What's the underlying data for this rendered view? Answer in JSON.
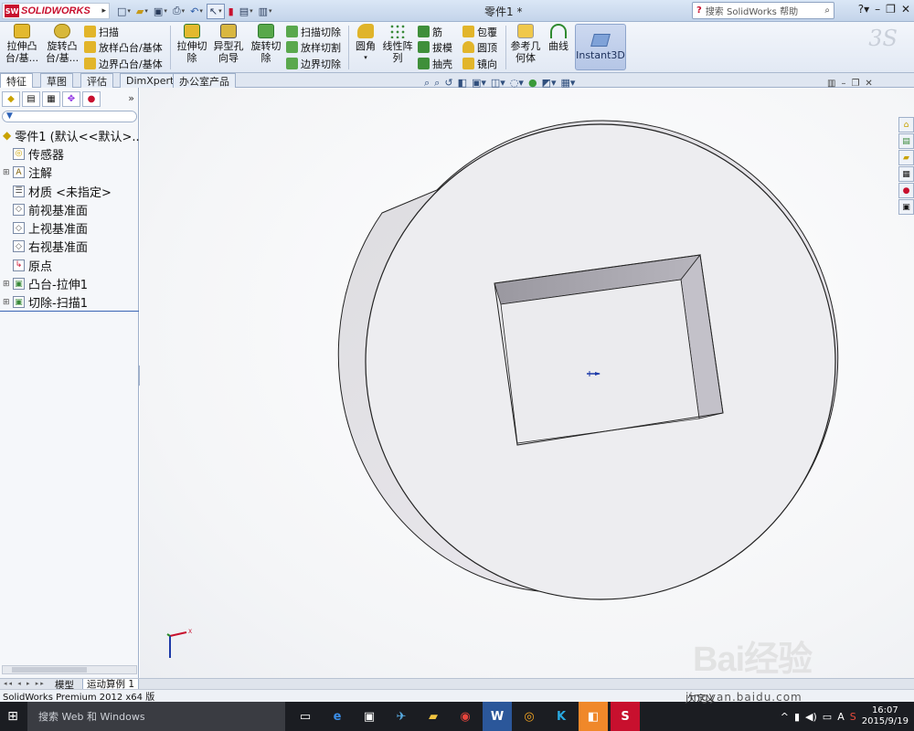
{
  "app": {
    "brand": "SOLIDWORKS",
    "doc_title": "零件1 *",
    "search_placeholder": "搜索 SolidWorks 帮助"
  },
  "quick_access": [
    "new-icon",
    "open-icon",
    "save-icon",
    "print-icon",
    "undo-icon",
    "select-icon",
    "rebuild-icon",
    "file-properties-icon",
    "options-icon"
  ],
  "ribbon": {
    "extrude_boss": "拉伸凸\n台/基...",
    "revolve_boss": "旋转凸\n台/基...",
    "sweep": "扫描",
    "loft_boss": "放样凸台/基体",
    "boundary_boss": "边界凸台/基体",
    "extrude_cut": "拉伸切\n除",
    "hole_wizard": "异型孔\n向导",
    "revolve_cut": "旋转切\n除",
    "sweep_cut": "扫描切除",
    "loft_cut": "放样切割",
    "boundary_cut": "边界切除",
    "fillet": "圆角",
    "linear_pattern": "线性阵\n列",
    "rib": "筋",
    "draft": "拔模",
    "shell": "抽壳",
    "wrap": "包覆",
    "dome": "圆顶",
    "mirror": "镜向",
    "ref_geometry": "参考几\n何体",
    "curves": "曲线",
    "instant3d": "Instant3D"
  },
  "tabs": [
    "特征",
    "草图",
    "评估",
    "DimXpert",
    "办公室产品"
  ],
  "tree": {
    "root": "零件1 (默认<<默认>...",
    "items": [
      {
        "label": "传感器",
        "icon": "sensor-icon",
        "expandable": false
      },
      {
        "label": "注解",
        "icon": "annotation-icon",
        "expandable": true
      },
      {
        "label": "材质 <未指定>",
        "icon": "material-icon",
        "expandable": false
      },
      {
        "label": "前视基准面",
        "icon": "plane-icon",
        "expandable": false
      },
      {
        "label": "上视基准面",
        "icon": "plane-icon",
        "expandable": false
      },
      {
        "label": "右视基准面",
        "icon": "plane-icon",
        "expandable": false
      },
      {
        "label": "原点",
        "icon": "origin-icon",
        "expandable": false
      },
      {
        "label": "凸台-拉伸1",
        "icon": "extrude-icon",
        "expandable": true
      },
      {
        "label": "切除-扫描1",
        "icon": "cut-sweep-icon",
        "expandable": true
      }
    ]
  },
  "bottom_tabs": [
    "模型",
    "运动算例 1"
  ],
  "status": {
    "left": "SolidWorks Premium 2012 x64 版",
    "right": "欠定义"
  },
  "taskbar": {
    "search": "搜索 Web 和 Windows",
    "time": "16:07",
    "date": "2015/9/19",
    "lang": "A"
  },
  "watermark": {
    "main": "Bai经验",
    "sub": "jingyan.baidu.com"
  },
  "colors": {
    "accent": "#c8102e",
    "model": "#ededf0",
    "taskbar": "#1b1d22"
  }
}
